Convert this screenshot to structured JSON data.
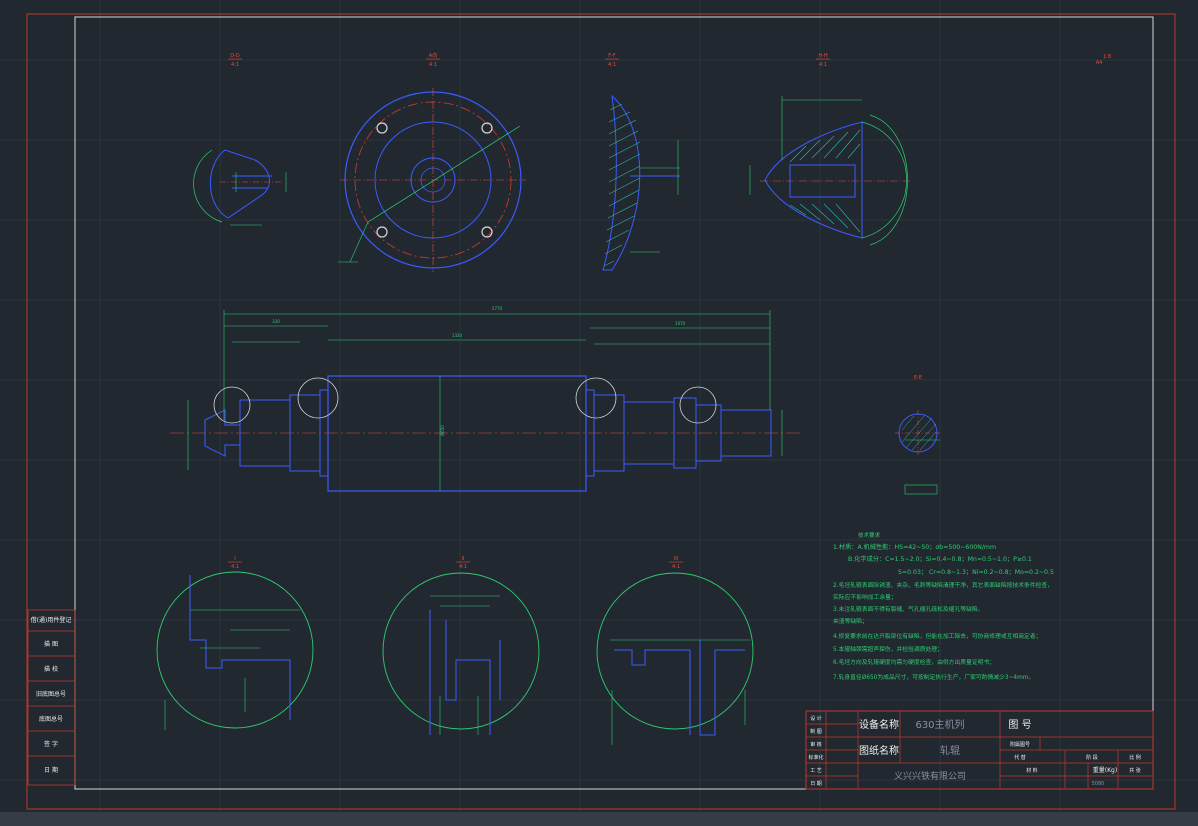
{
  "views": {
    "d_d": {
      "label": "D-D",
      "scale": "4:1"
    },
    "view_a": {
      "label": "A向",
      "scale": "4:1"
    },
    "f_f": {
      "label": "F-F",
      "scale": "4:1"
    },
    "h_h": {
      "label": "H-H",
      "scale": "4:1"
    },
    "e_e": {
      "label": "E-E",
      "scale": ""
    },
    "detail_i": {
      "label": "I",
      "scale": "4:1"
    },
    "detail_ii": {
      "label": "II",
      "scale": "4:1"
    },
    "detail_iii": {
      "label": "III",
      "scale": "4:1"
    }
  },
  "sheet_mark": {
    "code": "A4",
    "num": "1:8"
  },
  "shaft_dims": {
    "total": "2770",
    "left_part": "320",
    "mid": "1320",
    "right_part": "1070",
    "d_main": "Ø650"
  },
  "tech_req": {
    "title": "技术要求",
    "lines": [
      "1.材质：A.机械性能：HS=42~50；σb=500~600N/mm",
      "B.化学成分：C=1.5~2.0；Si=0.4~0.8；Mn=0.5~1.0；P≥0.1",
      "S=0.03；   Cr=0.8~1.3；Ni=0.2~0.8；Mo=0.2~0.5",
      "2.毛坯轧辊表面除锈渣、夹杂、毛刺等缺陷清理干净，其它表面缺陷按技术条件检查，",
      "  实际应不影响加工余量；",
      "3.未注轧辊表面不得有裂缝、气孔缩孔疏松及缩孔等缺陷，",
      "  夹渣等缺陷；",
      "4.修复要求前在达开裂部位有缺陷，但能在加工除去，可协商修理或互相商定者；",
      "5.本辊轴颈需超声探伤，并检验调质处理；",
      "6.毛坯方向及轧辊硬度均需匀硬度检查，由供方出质量证明书；",
      "7.轧身直径Ø650为成品尺寸，可按制定执行生产，厂家可酌情减少3~4mm。"
    ]
  },
  "left_table": [
    "借(通)用件登记",
    "描 图",
    "描 校",
    "旧底图总号",
    "底图总号",
    "签 字",
    "日 期"
  ],
  "title_block": {
    "row_labels": [
      "设 计",
      "制 图",
      "审 核",
      "标准化",
      "工 艺",
      "日 期"
    ],
    "equipment_label": "设备名称",
    "equipment_value": "630主机列",
    "drawing_name_label": "图纸名称",
    "drawing_name_value": "轧辊",
    "drawing_no_label": "图 号",
    "attach_label": "附属图号",
    "replace_label": "代 替",
    "stage_label": "阶 段",
    "ratio_label": "比 例",
    "material_label": "材 料",
    "weight_label": "重量(Kg)",
    "count_label": "共 张",
    "company": "义兴兴铁有限公司",
    "weight_value": "5080"
  }
}
